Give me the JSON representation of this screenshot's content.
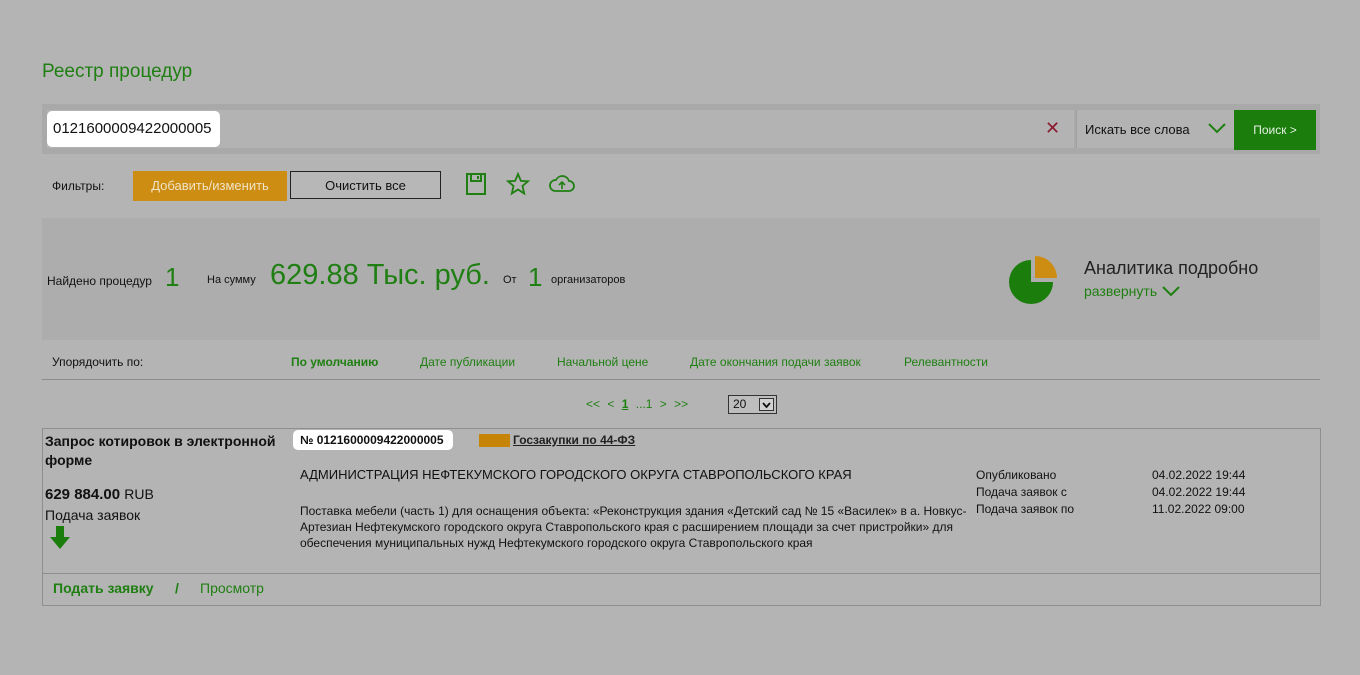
{
  "page_title": "Реестр процедур",
  "search": {
    "value": "0121600009422000005",
    "mode": "Искать все слова",
    "button": "Поиск >"
  },
  "filters": {
    "label": "Фильтры:",
    "add_button": "Добавить/изменить",
    "clear_button": "Очистить все"
  },
  "summary": {
    "found_label": "Найдено процедур",
    "found_count": "1",
    "sum_label": "На сумму",
    "sum_value": "629.88 Тыс. руб.",
    "from_label": "От",
    "organizers_count": "1",
    "organizers_label": "организаторов",
    "analytics_title": "Аналитика подробно",
    "analytics_expand": "развернуть"
  },
  "sort": {
    "label": "Упорядочить по:",
    "options": [
      "По умолчанию",
      "Дате публикации",
      "Начальной цене",
      "Дате окончания подачи заявок",
      "Релевантности"
    ]
  },
  "pagination": {
    "first": "<<",
    "prev": "<",
    "current": "1",
    "ellipsis": "...1",
    "next": ">",
    "last": ">>",
    "per_page": "20"
  },
  "result": {
    "type": "Запрос котировок в электронной форме",
    "price": "629 884.00",
    "currency": "RUB",
    "stage": "Подача заявок",
    "number": "№ 0121600009422000005",
    "law": "Госзакупки по 44-ФЗ",
    "customer": "АДМИНИСТРАЦИЯ НЕФТЕКУМСКОГО ГОРОДСКОГО ОКРУГА СТАВРОПОЛЬСКОГО КРАЯ",
    "subject": "Поставка мебели (часть 1) для оснащения объекта: «Реконструкция здания «Детский сад № 15 «Василек» в а. Новкус-Артезиан Нефтекумского городского округа Ставропольского края с расширением площади за счет пристройки» для обеспечения муниципальных нужд Нефтекумского городского округа Ставропольского края",
    "dates": [
      {
        "label": "Опубликовано",
        "value": "04.02.2022 19:44"
      },
      {
        "label": "Подача заявок с",
        "value": "04.02.2022 19:44"
      },
      {
        "label": "Подача заявок по",
        "value": "11.02.2022 09:00"
      }
    ],
    "apply_link": "Подать заявку",
    "separator": "/",
    "view_link": "Просмотр"
  },
  "colors": {
    "accent_green": "#1f7f12",
    "accent_orange": "#cc8d12",
    "background": "#b4b4b4"
  }
}
